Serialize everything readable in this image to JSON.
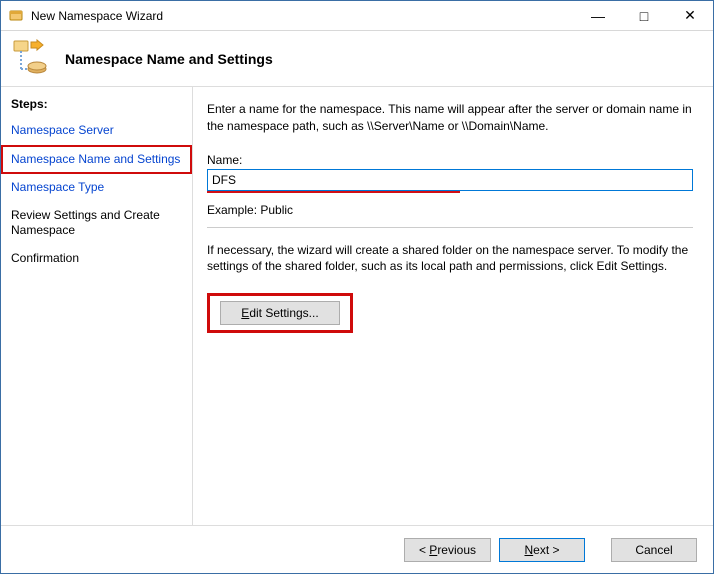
{
  "window": {
    "title": "New Namespace Wizard"
  },
  "header": {
    "title": "Namespace Name and Settings"
  },
  "sidebar": {
    "stepsLabel": "Steps:",
    "items": [
      {
        "label": "Namespace Server",
        "state": "done"
      },
      {
        "label": "Namespace Name and Settings",
        "state": "current"
      },
      {
        "label": "Namespace Type",
        "state": "done"
      },
      {
        "label": "Review Settings and Create Namespace",
        "state": "pending"
      },
      {
        "label": "Confirmation",
        "state": "pending"
      }
    ]
  },
  "content": {
    "intro": "Enter a name for the namespace. This name will appear after the server or domain name in the namespace path, such as \\\\Server\\Name or \\\\Domain\\Name.",
    "nameLabel": "Name:",
    "nameValue": "DFS",
    "exampleLabel": "Example: Public",
    "infoText": "If necessary, the wizard will create a shared folder on the namespace server. To modify the settings of the shared folder, such as its local path and permissions, click Edit Settings.",
    "editSettingsLabel": "Edit Settings..."
  },
  "footer": {
    "previous": "Previous",
    "next": "Next",
    "cancel": "Cancel"
  }
}
